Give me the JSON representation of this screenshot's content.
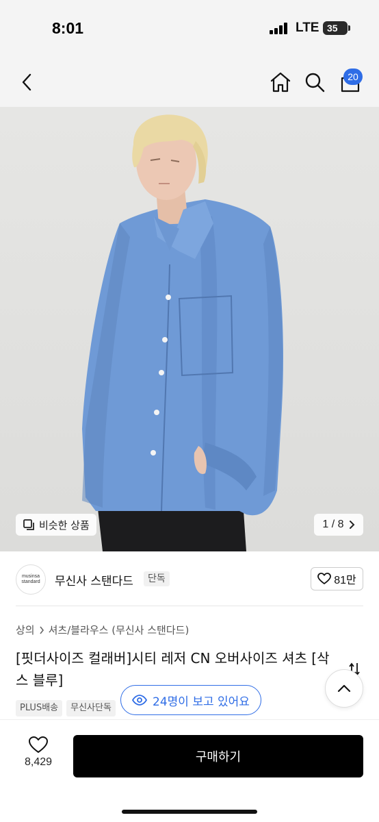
{
  "status_bar": {
    "time": "8:01",
    "network": "LTE",
    "battery": "35"
  },
  "header": {
    "back_icon": "chevron-left-icon",
    "home_icon": "home-icon",
    "search_icon": "search-icon",
    "cart_icon": "shopping-bag-icon",
    "cart_count": "20"
  },
  "gallery": {
    "similar_label": "비슷한 상품",
    "pager": "1 / 8"
  },
  "brand": {
    "logo_line1": "musinsa",
    "logo_line2": "standard",
    "name": "무신사 스탠다드",
    "tag": "단독",
    "likes": "81만"
  },
  "breadcrumb": {
    "level1": "상의",
    "level2": "셔츠/블라우스 (무신사 스탠다드)"
  },
  "product": {
    "title": "[핏더사이즈 컬래버]시티 레저 CN 오버사이즈 셔츠 [삭스 블루]",
    "tags": [
      "PLUS배송",
      "무신사단독"
    ]
  },
  "viewers": {
    "text": "24명이 보고 있어요"
  },
  "bottom": {
    "wish_count": "8,429",
    "buy_label": "구매하기"
  },
  "colors": {
    "accent": "#2f6de6",
    "buy_button": "#000000",
    "shirt": "#6f9ad6"
  }
}
